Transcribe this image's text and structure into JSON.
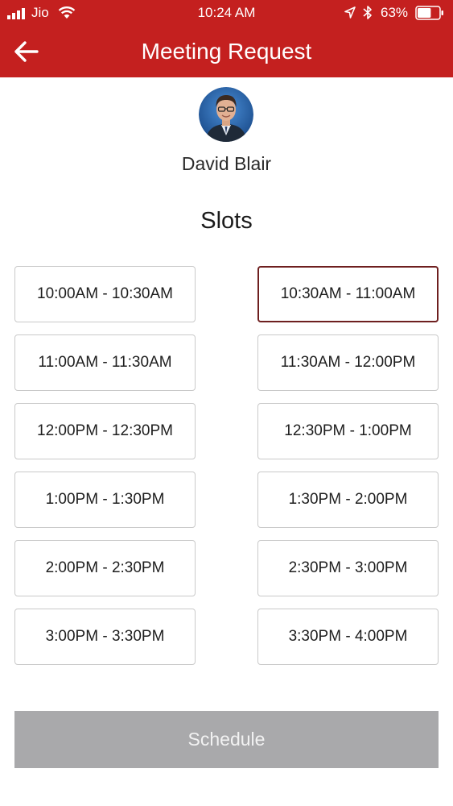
{
  "status_bar": {
    "carrier": "Jio",
    "time": "10:24 AM",
    "battery_percent": "63%",
    "battery_level": 0.63,
    "icons": [
      "signal-icon",
      "wifi-icon",
      "location-arrow-icon",
      "bluetooth-icon",
      "battery-icon"
    ]
  },
  "header": {
    "title": "Meeting Request",
    "back_icon": "back-arrow-icon"
  },
  "profile": {
    "name": "David Blair",
    "avatar": "avatar-photo"
  },
  "slots": {
    "title": "Slots",
    "items": [
      {
        "label": "10:00AM - 10:30AM",
        "selected": false
      },
      {
        "label": "10:30AM - 11:00AM",
        "selected": true
      },
      {
        "label": "11:00AM - 11:30AM",
        "selected": false
      },
      {
        "label": "11:30AM - 12:00PM",
        "selected": false
      },
      {
        "label": "12:00PM - 12:30PM",
        "selected": false
      },
      {
        "label": "12:30PM - 1:00PM",
        "selected": false
      },
      {
        "label": "1:00PM - 1:30PM",
        "selected": false
      },
      {
        "label": "1:30PM - 2:00PM",
        "selected": false
      },
      {
        "label": "2:00PM - 2:30PM",
        "selected": false
      },
      {
        "label": "2:30PM - 3:00PM",
        "selected": false
      },
      {
        "label": "3:00PM - 3:30PM",
        "selected": false
      },
      {
        "label": "3:30PM - 4:00PM",
        "selected": false
      }
    ]
  },
  "schedule_button": {
    "label": "Schedule"
  },
  "colors": {
    "header_bg": "#c4201f",
    "selected_border": "#6e1f1f",
    "slot_border": "#c9c9c9",
    "button_disabled_bg": "#a9a9ab"
  }
}
